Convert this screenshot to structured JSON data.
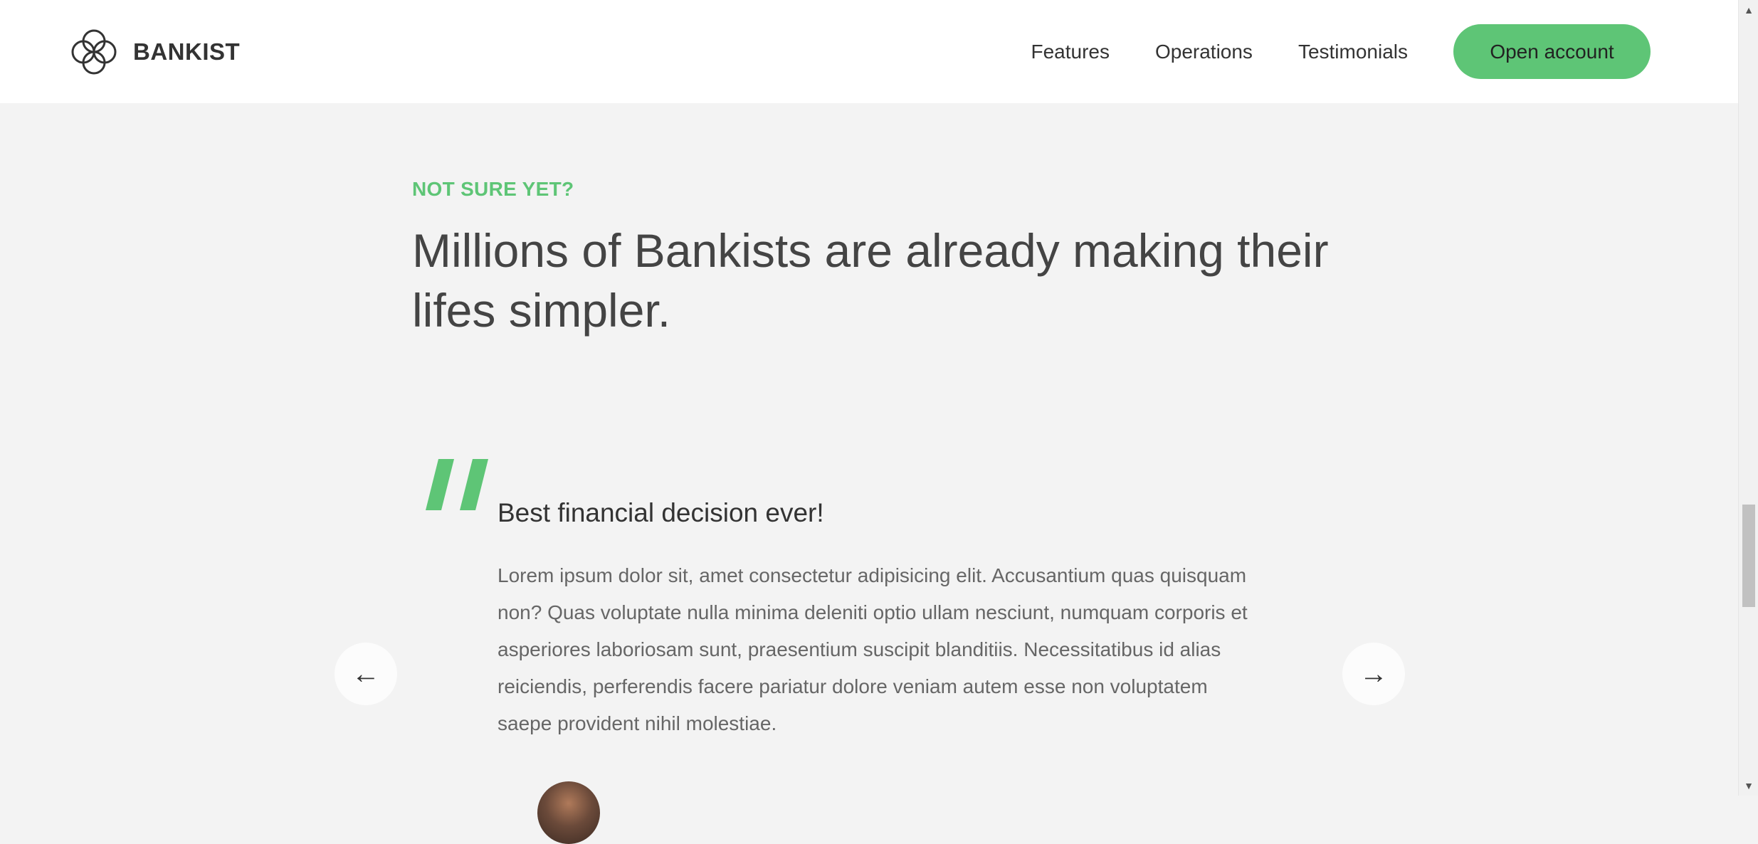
{
  "nav": {
    "logo_text": "BANKIST",
    "links": [
      "Features",
      "Operations",
      "Testimonials"
    ],
    "cta_label": "Open account"
  },
  "section": {
    "description": "NOT SURE YET?",
    "title": "Millions of Bankists are already making their lifes simpler."
  },
  "testimonial": {
    "header": "Best financial decision ever!",
    "text": "Lorem ipsum dolor sit, amet consectetur adipisicing elit. Accusantium quas quisquam non? Quas voluptate nulla minima deleniti optio ullam nesciunt, numquam corporis et asperiores laboriosam sunt, praesentium suscipit blanditiis. Necessitatibus id alias reiciendis, perferendis facere pariatur dolore veniam autem esse non voluptatem saepe provident nihil molestiae.",
    "prev_icon": "←",
    "next_icon": "→"
  },
  "scrollbar": {
    "up_icon": "▲",
    "down_icon": "▼"
  },
  "colors": {
    "accent": "#5ec576",
    "nav_bg": "#ffffff",
    "page_bg": "#f3f3f3",
    "heading": "#444444"
  }
}
